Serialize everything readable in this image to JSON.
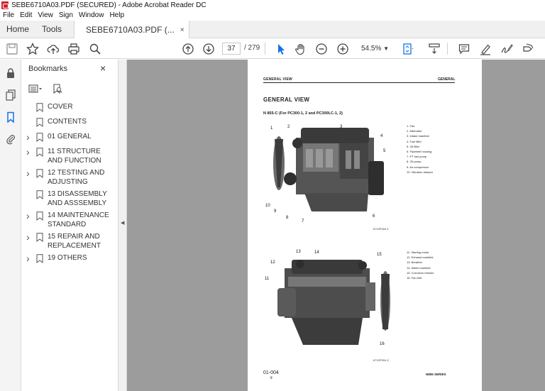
{
  "window": {
    "title": "SEBE6710A03.PDF (SECURED) - Adobe Acrobat Reader DC"
  },
  "menu": [
    "File",
    "Edit",
    "View",
    "Sign",
    "Window",
    "Help"
  ],
  "tabs": {
    "home": "Home",
    "tools": "Tools",
    "doc": "SEBE6710A03.PDF (...",
    "close": "×"
  },
  "toolbar": {
    "page_current": "37",
    "page_total": "/ 279",
    "zoom": "54.5%"
  },
  "bookmarks": {
    "header": "Bookmarks",
    "close": "×",
    "items": [
      {
        "label": "COVER",
        "expandable": false
      },
      {
        "label": "CONTENTS",
        "expandable": false
      },
      {
        "label": "01 GENERAL",
        "expandable": true
      },
      {
        "label": "11 STRUCTURE AND FUNCTION",
        "expandable": true
      },
      {
        "label": "12 TESTING AND ADJUSTING",
        "expandable": true
      },
      {
        "label": "13 DISASSEMBLY AND ASSSEMBLY",
        "expandable": false
      },
      {
        "label": "14 MAINTENANCE STANDARD",
        "expandable": true
      },
      {
        "label": "15 REPAIR AND REPLACEMENT",
        "expandable": true
      },
      {
        "label": "19 OTHERS",
        "expandable": true
      }
    ]
  },
  "page": {
    "header_left": "GENERAL VIEW",
    "header_right": "GENERAL",
    "title": "GENERAL VIEW",
    "subtitle": "N 855-C (For PC300-1, 2 and PC300LC-1, 2)",
    "legend1": [
      "1.   Fan",
      "2.   Alternator",
      "3.   Intake manifold",
      "4.   Fuel filter",
      "5.   Oil filter",
      "6.   Flywheel housing",
      "7.   PT fuel pump",
      "8.   Oil pump",
      "9.   Air compressor",
      "10.  Vibration damper"
    ],
    "legend2": [
      "11.  Starting motor",
      "12.  Exhaust manifold",
      "13.  Breather",
      "14.  Water manifold",
      "15.  Corrosion resistor",
      "16.  Fan belt"
    ],
    "fig1_code": "6710P004-1",
    "fig2_code": "6710P004-2",
    "callouts1": [
      "1",
      "2",
      "3",
      "4",
      "5",
      "6",
      "7",
      "8",
      "9",
      "10"
    ],
    "callouts2": [
      "11",
      "12",
      "13",
      "14",
      "15",
      "16"
    ],
    "footer_left": "01-004",
    "footer_sub": "③",
    "footer_right": "N855 SERIES"
  }
}
